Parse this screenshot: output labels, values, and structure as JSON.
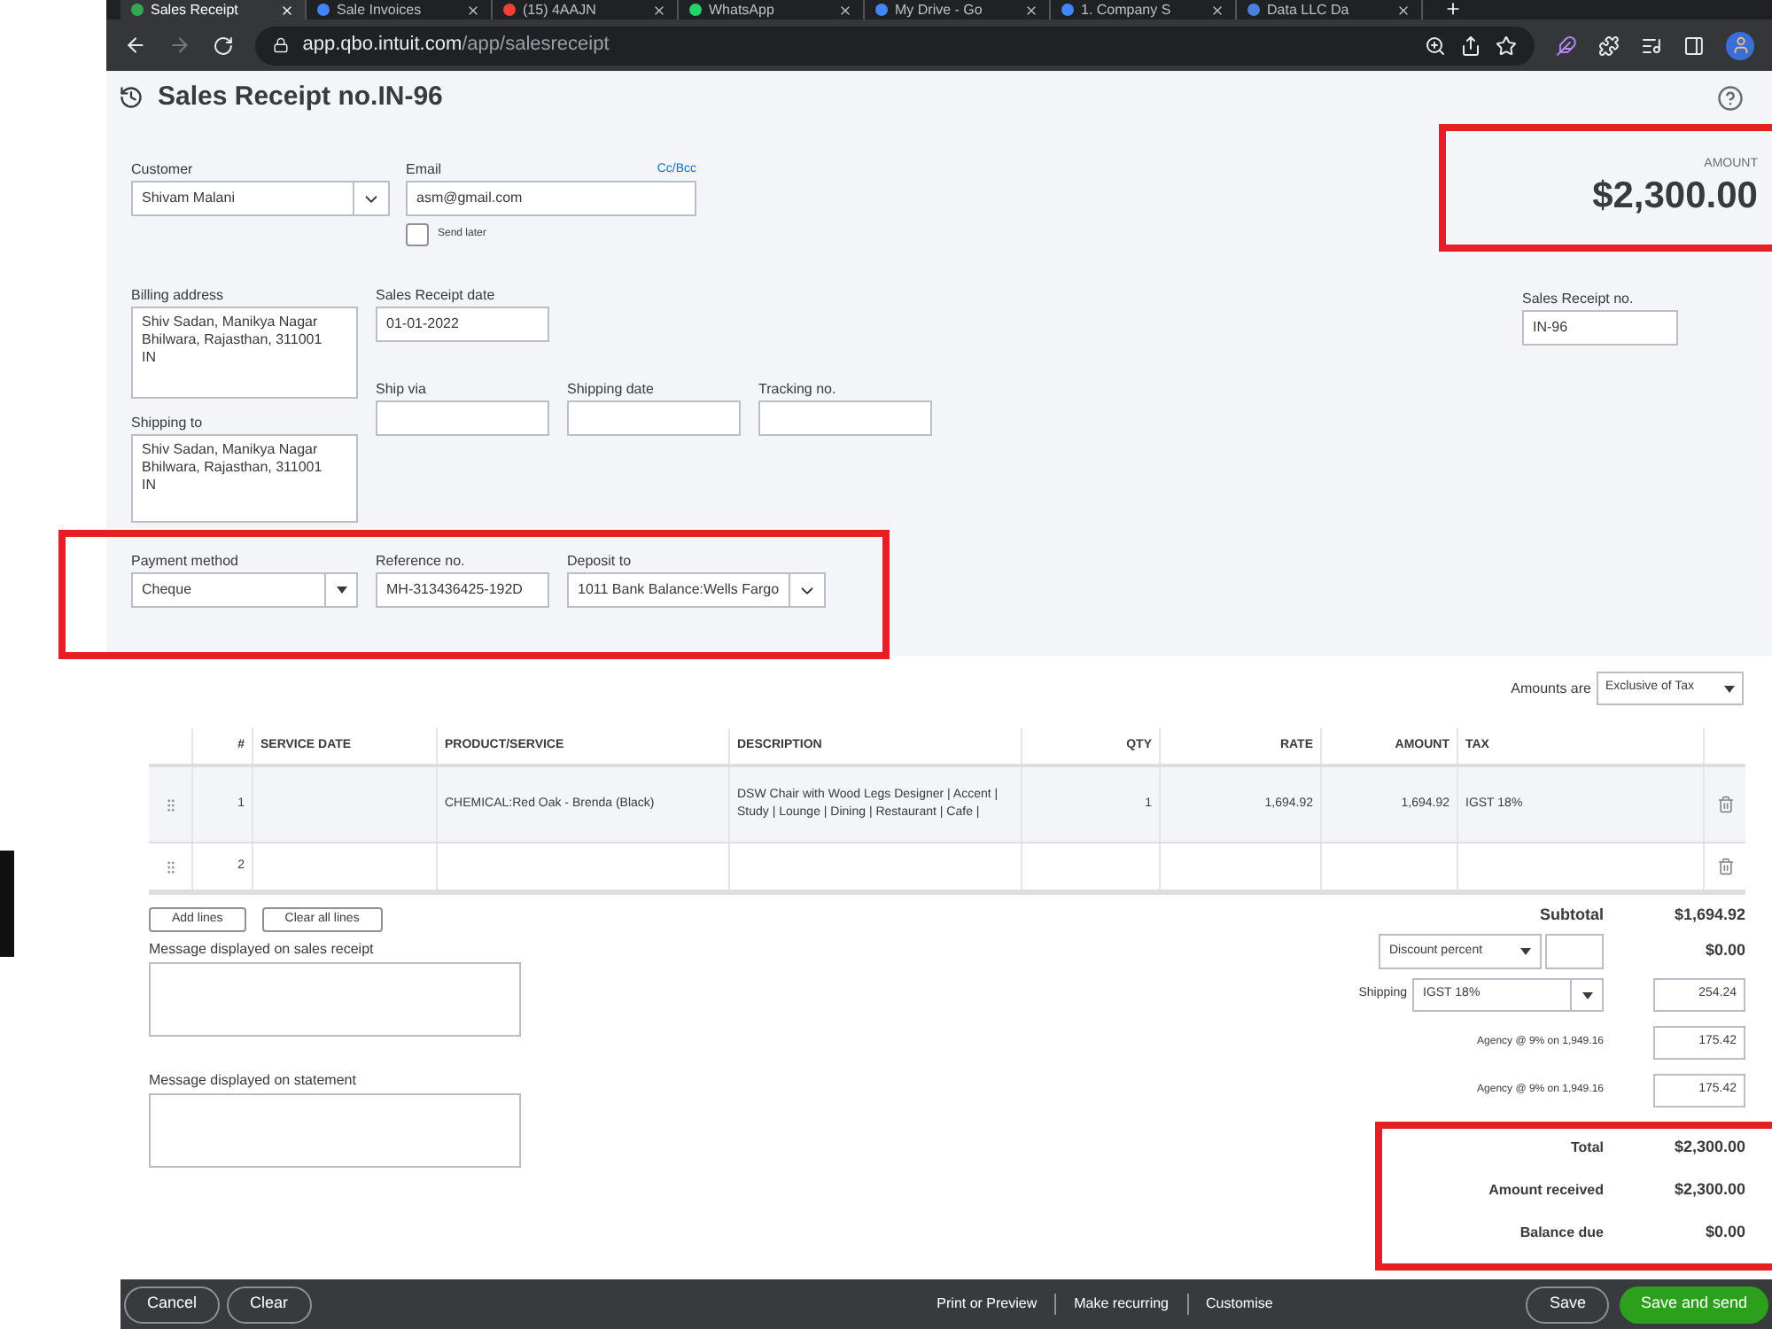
{
  "browser": {
    "tabs": [
      {
        "title": "Sales Receipt",
        "selected": true,
        "color": "#34a853"
      },
      {
        "title": "Sale Invoices",
        "selected": false,
        "color": "#4285f4"
      },
      {
        "title": "(15) 4AAJN",
        "selected": false,
        "color": "#ea4335"
      },
      {
        "title": "WhatsApp",
        "selected": false,
        "color": "#25d366"
      },
      {
        "title": "My Drive - Go",
        "selected": false,
        "color": "#4285f4"
      },
      {
        "title": "1. Company S",
        "selected": false,
        "color": "#4285f4"
      },
      {
        "title": "Data LLC Da",
        "selected": false,
        "color": "#4a7fe0"
      }
    ],
    "url_host": "app.qbo.intuit.com",
    "url_path": "/app/salesreceipt"
  },
  "page": {
    "title": "Sales Receipt no.IN-96",
    "amount_label": "AMOUNT",
    "amount": "$2,300.00",
    "amount_highlighted": true
  },
  "customer": {
    "label": "Customer",
    "value": "Shivam Malani"
  },
  "email": {
    "label": "Email",
    "value": "asm@gmail.com",
    "cc_bcc": "Cc/Bcc"
  },
  "send_later": {
    "label": "Send later",
    "checked": false
  },
  "billing_address": {
    "label": "Billing address",
    "value": "Shiv Sadan, Manikya Nagar\nBhilwara, Rajasthan, 311001\nIN"
  },
  "shipping_to": {
    "label": "Shipping to",
    "value": "Shiv Sadan, Manikya Nagar\nBhilwara, Rajasthan, 311001\nIN"
  },
  "sales_receipt_date": {
    "label": "Sales Receipt date",
    "value": "01-01-2022"
  },
  "shipping_fields": [
    {
      "label": "Ship via"
    },
    {
      "label": "Shipping date"
    },
    {
      "label": "Tracking no."
    }
  ],
  "sales_receipt_no": {
    "label": "Sales Receipt no.",
    "value": "IN-96"
  },
  "payment": {
    "highlighted": true,
    "fields": [
      {
        "label": "Payment method",
        "value": "Cheque",
        "kind": "select"
      },
      {
        "label": "Reference no.",
        "value": "MH-313436425-192D",
        "kind": "text"
      },
      {
        "label": "Deposit to",
        "value": "1011 Bank Balance:Wells Fargo",
        "kind": "combo"
      }
    ]
  },
  "amounts_are": {
    "label": "Amounts are",
    "value": "Exclusive of Tax"
  },
  "table": {
    "columns": [
      "#",
      "SERVICE DATE",
      "PRODUCT/SERVICE",
      "DESCRIPTION",
      "QTY",
      "RATE",
      "AMOUNT",
      "TAX"
    ],
    "rows": [
      {
        "selected": true,
        "number": "1",
        "product": "CHEMICAL:Red Oak - Brenda (Black)",
        "description": "DSW Chair with Wood Legs Designer | Accent | Study | Lounge | Dining | Restaurant | Cafe |",
        "qty": "1",
        "rate": "1,694.92",
        "amount": "1,694.92",
        "tax": "IGST 18%"
      },
      {
        "selected": false,
        "number": "2"
      }
    ]
  },
  "line_buttons": [
    "Add lines",
    "Clear all lines"
  ],
  "messages": [
    {
      "label": "Message displayed on sales receipt"
    },
    {
      "label": "Message displayed on statement"
    }
  ],
  "totals": {
    "subtotal": {
      "label": "Subtotal",
      "value": "$1,694.92"
    },
    "discount": {
      "type": "Discount percent",
      "value": "$0.00"
    },
    "shipping": {
      "label": "Shipping",
      "tax": "IGST 18%",
      "value": "254.24"
    },
    "taxes": [
      {
        "label": "Agency @ 9% on 1,949.16",
        "value": "175.42"
      },
      {
        "label": "Agency @ 9% on 1,949.16",
        "value": "175.42"
      }
    ],
    "summary": [
      {
        "label": "Total",
        "value": "$2,300.00"
      },
      {
        "label": "Amount received",
        "value": "$2,300.00"
      },
      {
        "label": "Balance due",
        "value": "$0.00"
      }
    ],
    "highlighted": true
  },
  "footer": {
    "left": [
      "Cancel",
      "Clear"
    ],
    "center": [
      "Print or Preview",
      "Make recurring",
      "Customise"
    ],
    "right": [
      {
        "label": "Save",
        "kind": "outline"
      },
      {
        "label": "Save and send",
        "kind": "primary"
      }
    ]
  }
}
